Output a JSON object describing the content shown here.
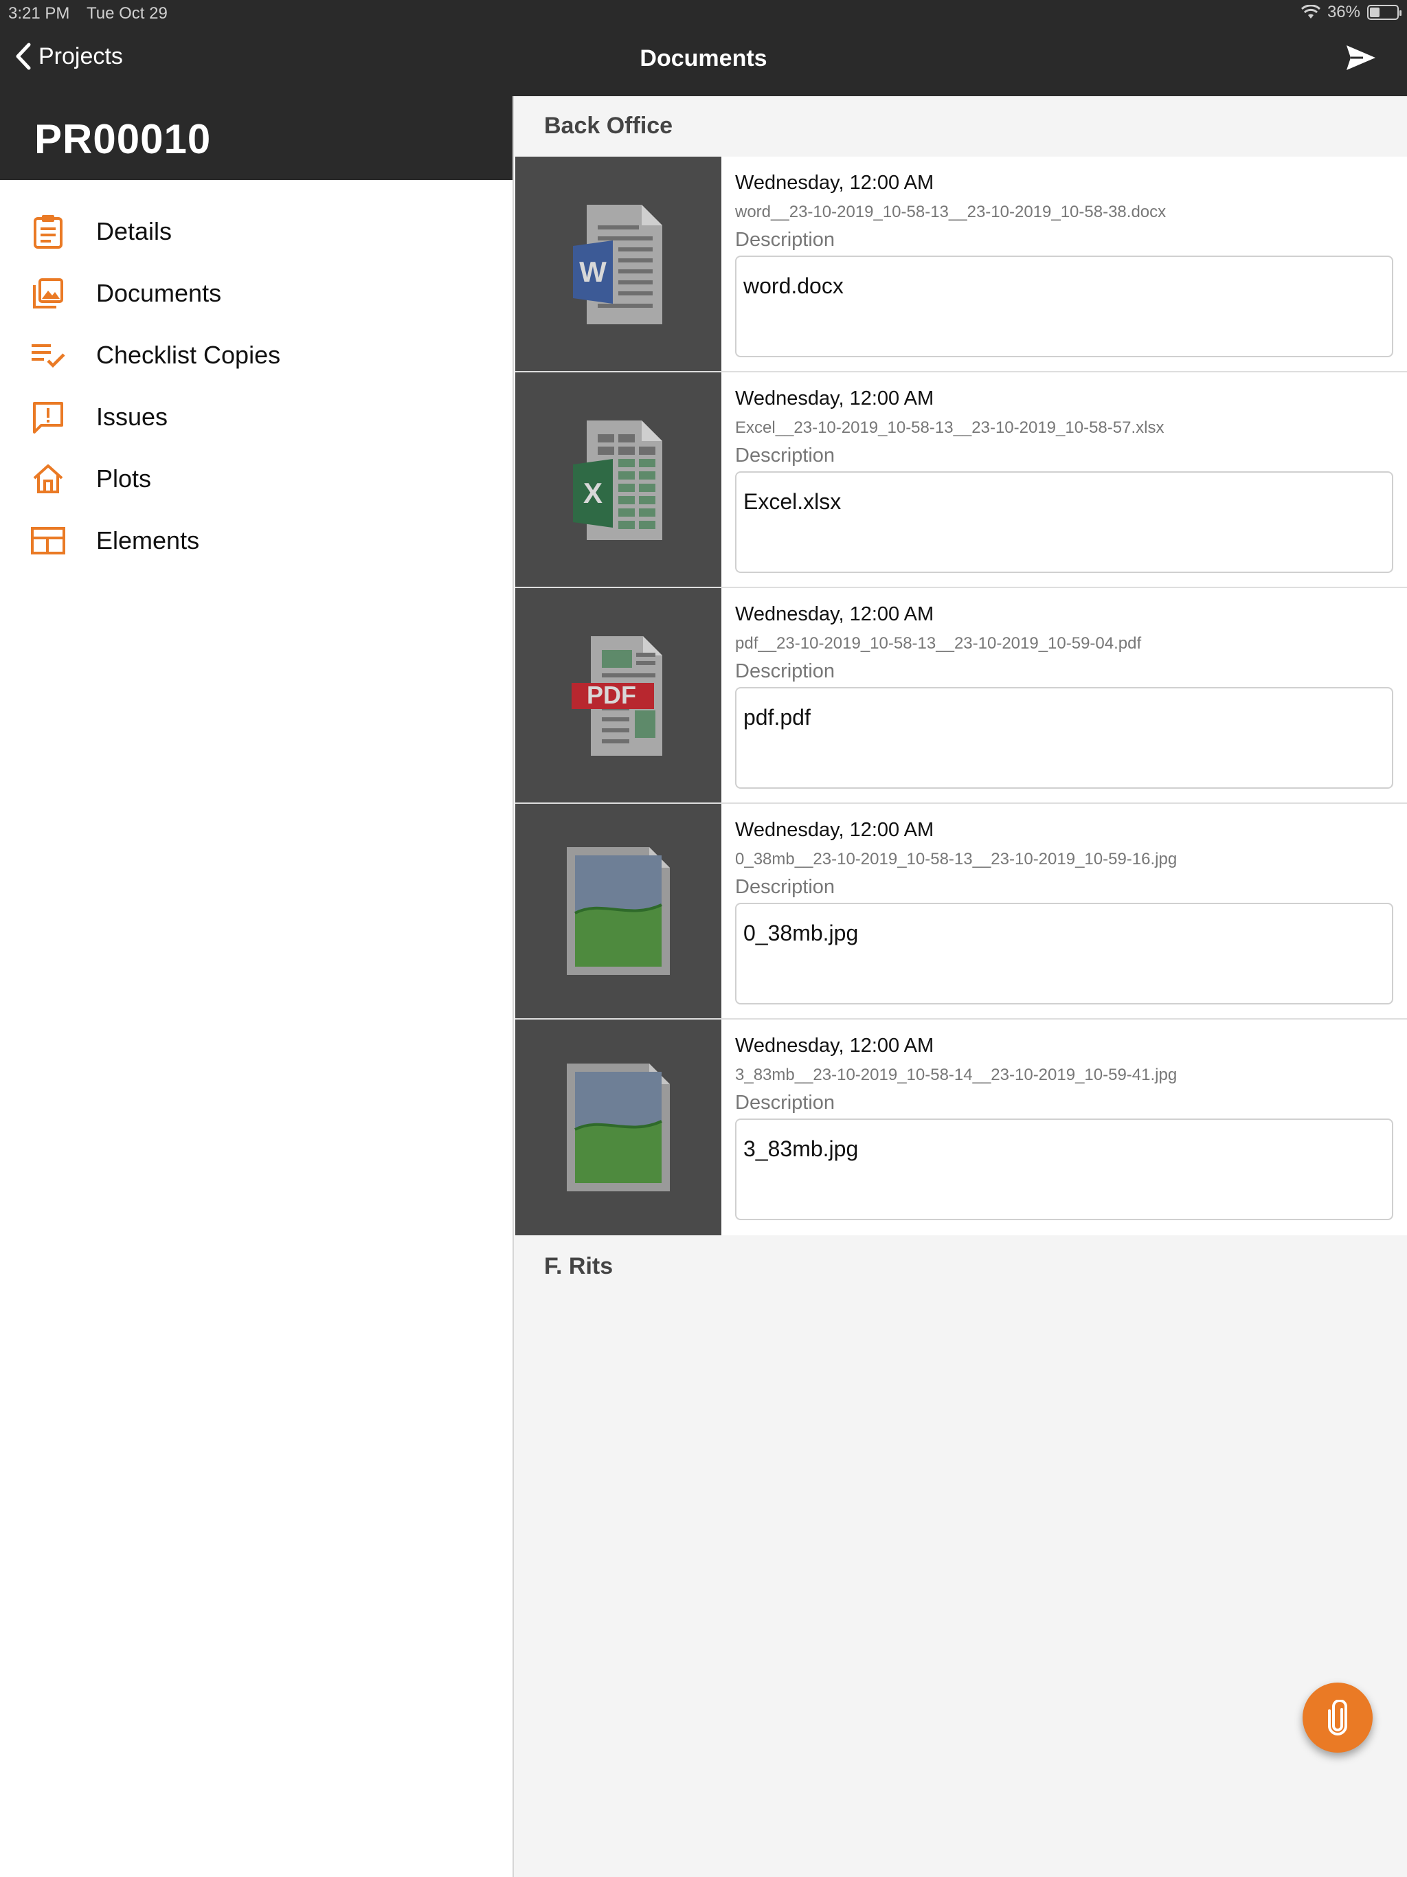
{
  "status_bar": {
    "time": "3:21 PM",
    "date": "Tue Oct 29",
    "battery": "36%",
    "battery_level": 0.36
  },
  "nav": {
    "back_label": "Projects",
    "title": "Documents"
  },
  "sidebar": {
    "project_code": "PR00010",
    "items": [
      {
        "label": "Details",
        "icon": "clipboard-icon"
      },
      {
        "label": "Documents",
        "icon": "gallery-icon"
      },
      {
        "label": "Checklist Copies",
        "icon": "checklist-icon"
      },
      {
        "label": "Issues",
        "icon": "issue-icon"
      },
      {
        "label": "Plots",
        "icon": "home-icon"
      },
      {
        "label": "Elements",
        "icon": "elements-icon"
      }
    ]
  },
  "main": {
    "sections": [
      {
        "title": "Back Office",
        "documents": [
          {
            "type": "word",
            "date": "Wednesday, 12:00 AM",
            "file": "word__23-10-2019_10-58-13__23-10-2019_10-58-38.docx",
            "description_label": "Description",
            "description": "word.docx"
          },
          {
            "type": "excel",
            "date": "Wednesday, 12:00 AM",
            "file": "Excel__23-10-2019_10-58-13__23-10-2019_10-58-57.xlsx",
            "description_label": "Description",
            "description": "Excel.xlsx"
          },
          {
            "type": "pdf",
            "date": "Wednesday, 12:00 AM",
            "file": "pdf__23-10-2019_10-58-13__23-10-2019_10-59-04.pdf",
            "description_label": "Description",
            "description": "pdf.pdf"
          },
          {
            "type": "image",
            "date": "Wednesday, 12:00 AM",
            "file": "0_38mb__23-10-2019_10-58-13__23-10-2019_10-59-16.jpg",
            "description_label": "Description",
            "description": "0_38mb.jpg"
          },
          {
            "type": "image",
            "date": "Wednesday, 12:00 AM",
            "file": "3_83mb__23-10-2019_10-58-14__23-10-2019_10-59-41.jpg",
            "description_label": "Description",
            "description": "3_83mb.jpg"
          }
        ]
      },
      {
        "title": "F. Rits",
        "documents": []
      }
    ]
  },
  "fab": {
    "icon": "paperclip-icon"
  },
  "colors": {
    "accent": "#ea7a25",
    "bar": "#2a2a2a",
    "thumb_bg": "#4a4a4a"
  }
}
